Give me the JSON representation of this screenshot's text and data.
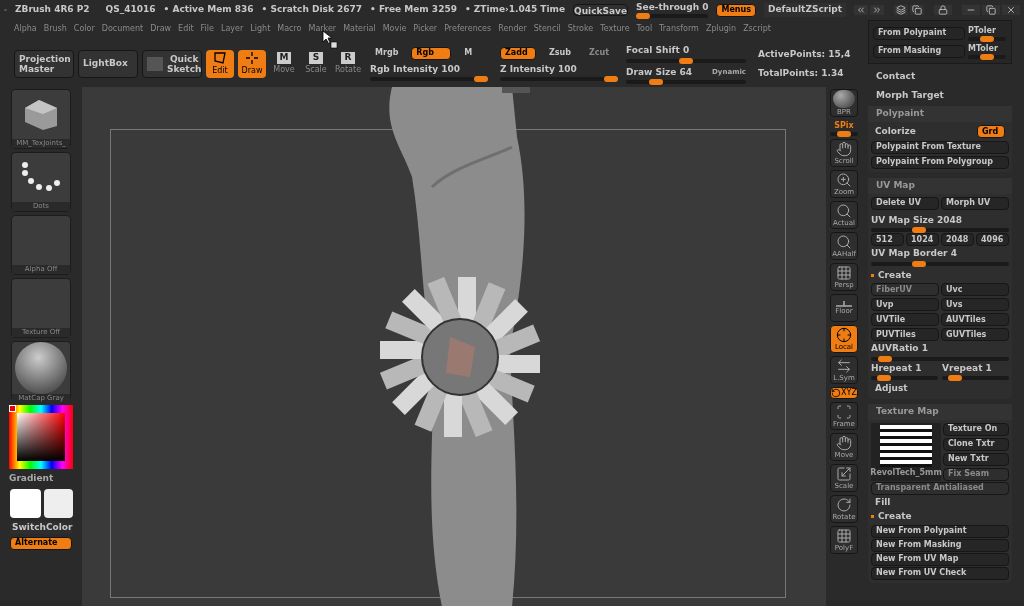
{
  "title_bar": {
    "app": "ZBrush 4R6 P2",
    "file": "QS_41016",
    "stats": [
      "• Active Mem 836",
      "• Scratch Disk 2677",
      "• Free Mem 3259",
      "• ZTime›1.045 Time"
    ],
    "quicksave": "QuickSave",
    "see_through": {
      "label": "See-through",
      "value": "0",
      "level": 0.05
    },
    "menus": {
      "label": "Menus",
      "on": true
    },
    "script": "DefaultZScript"
  },
  "menu": [
    "Alpha",
    "Brush",
    "Color",
    "Document",
    "Draw",
    "Edit",
    "File",
    "Layer",
    "Light",
    "Macro",
    "Marker",
    "Material",
    "Movie",
    "Picker",
    "Preferences",
    "Render",
    "Stencil",
    "Stroke",
    "Texture",
    "Tool",
    "Transform",
    "Zplugin",
    "Zscript"
  ],
  "toolbar": {
    "projection_master": "Projection Master",
    "lightbox": "LightBox",
    "quick_sketch": "Quick Sketch",
    "tools": [
      {
        "label": "Edit",
        "kind": "edit",
        "on": true
      },
      {
        "label": "Draw",
        "kind": "draw",
        "on": true
      },
      {
        "label": "Move",
        "kind": "transform",
        "key": "M",
        "on": false
      },
      {
        "label": "Scale",
        "kind": "transform",
        "key": "S",
        "on": false
      },
      {
        "label": "Rotate",
        "kind": "transform",
        "key": "R",
        "on": false
      }
    ],
    "color_modes": [
      {
        "label": "Mrgb",
        "on": false
      },
      {
        "label": "Rgb",
        "on": true
      },
      {
        "label": "M",
        "on": false
      }
    ],
    "depth_modes": [
      {
        "label": "Zadd",
        "on": true,
        "disabled": false
      },
      {
        "label": "Zsub",
        "on": false,
        "disabled": false
      },
      {
        "label": "Zcut",
        "on": false,
        "disabled": true
      }
    ],
    "sliders": [
      {
        "label": "Rgb Intensity",
        "value": "100",
        "level": 0.95
      },
      {
        "label": "Z Intensity",
        "value": "100",
        "level": 0.95
      },
      {
        "label": "Focal Shift",
        "value": "0",
        "level": 0.5
      },
      {
        "label": "Draw Size",
        "value": "64",
        "level": 0.25,
        "note": "Dynamic"
      }
    ],
    "stats": [
      "ActivePoints: 15,4",
      "TotalPoints: 1.34"
    ]
  },
  "left_shelf": {
    "tiles": [
      {
        "label": "MM_TexJoints_",
        "kind": "brush"
      },
      {
        "label": "Dots",
        "kind": "stroke"
      },
      {
        "label": "Alpha Off",
        "kind": "empty"
      },
      {
        "label": "Texture Off",
        "kind": "empty"
      },
      {
        "label": "MatCap Gray",
        "kind": "material"
      }
    ],
    "gradient": "Gradient",
    "switch_color": "SwitchColor",
    "alternate": {
      "label": "Alternate",
      "on": true
    }
  },
  "right_shelf": [
    {
      "label": "BPR",
      "kind": "bpr",
      "on": false
    },
    {
      "label": "SPix",
      "kind": "slider",
      "level": 0.5
    },
    {
      "label": "Scroll",
      "kind": "scroll",
      "on": false
    },
    {
      "label": "Zoom",
      "kind": "zoom",
      "on": false
    },
    {
      "label": "Actual",
      "kind": "actual",
      "on": false
    },
    {
      "label": "AAHalf",
      "kind": "actual",
      "on": false
    },
    {
      "label": "Persp",
      "kind": "grid",
      "on": false
    },
    {
      "label": "Floor",
      "kind": "floor",
      "on": false
    },
    {
      "label": "Local",
      "kind": "local",
      "on": true
    },
    {
      "label": "L.Sym",
      "kind": "sym",
      "on": false
    },
    {
      "label": "XYZ",
      "kind": "xyz",
      "on": true
    },
    {
      "label": "Frame",
      "kind": "frame",
      "on": false
    },
    {
      "label": "Move",
      "kind": "move",
      "on": false
    },
    {
      "label": "Scale",
      "kind": "scale",
      "on": false
    },
    {
      "label": "Rotate",
      "kind": "rotate",
      "on": false
    },
    {
      "label": "PolyF",
      "kind": "grid",
      "on": false
    }
  ],
  "right_panel": {
    "popup": [
      {
        "button": "From Polypaint",
        "slider": "PToler",
        "level": 0.5
      },
      {
        "button": "From Masking",
        "slider": "MToler",
        "level": 0.5
      }
    ],
    "contact": "Contact",
    "morph_target": "Morph Target",
    "polypaint": {
      "title": "Polypaint",
      "colorize": "Colorize",
      "grd": {
        "label": "Grd",
        "on": true
      },
      "buttons": [
        "Polypaint From Texture",
        "Polypaint From Polygroup"
      ]
    },
    "uv_map": {
      "title": "UV Map",
      "top": [
        "Delete UV",
        "Morph UV"
      ],
      "size": {
        "label": "UV Map Size",
        "value": "2048",
        "level": 0.35
      },
      "sizes": [
        "512",
        "1024",
        "2048",
        "4096"
      ],
      "border": {
        "label": "UV Map Border",
        "value": "4",
        "level": 0.35
      },
      "create": "Create",
      "buttons": [
        {
          "label": "FiberUV",
          "disabled": true
        },
        {
          "label": "Uvc",
          "disabled": false
        },
        {
          "label": "Uvp",
          "disabled": false
        },
        {
          "label": "Uvs",
          "disabled": false
        },
        {
          "label": "UVTile",
          "disabled": false
        },
        {
          "label": "AUVTiles",
          "disabled": false
        },
        {
          "label": "PUVTiles",
          "disabled": false
        },
        {
          "label": "GUVTiles",
          "disabled": false
        }
      ],
      "ratio": {
        "label": "AUVRatio",
        "value": "1",
        "level": 0.1
      },
      "repeats": [
        {
          "label": "Hrepeat",
          "value": "1",
          "level": 0.2
        },
        {
          "label": "Vrepeat",
          "value": "1",
          "level": 0.2
        }
      ],
      "adjust": "Adjust"
    },
    "texture_map": {
      "title": "Texture Map",
      "thumb_label": "RevolTech_5mm",
      "buttons": [
        {
          "label": "Texture On",
          "disabled": false
        },
        {
          "label": "Clone Txtr",
          "disabled": false
        },
        {
          "label": "New Txtr",
          "disabled": false
        },
        {
          "label": "Fix Seam",
          "disabled": true
        }
      ],
      "transparent": {
        "label": "Transparent Antialiased",
        "disabled": true
      },
      "fill": "Fill",
      "create": "Create",
      "new_buttons": [
        "New From Polypaint",
        "New From Masking",
        "New From UV Map",
        "New From UV Check"
      ]
    }
  }
}
